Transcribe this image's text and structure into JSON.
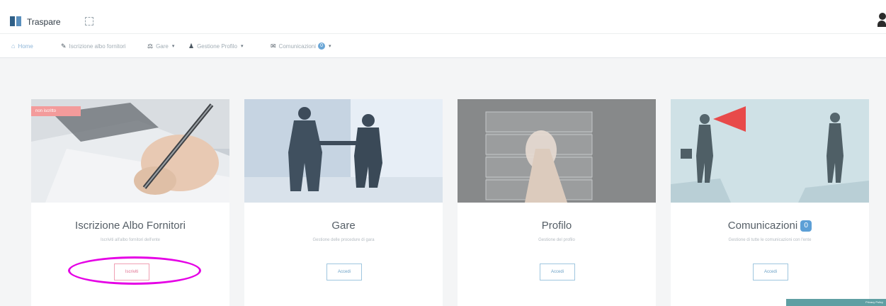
{
  "app": {
    "title": "Traspare"
  },
  "nav": {
    "items": [
      {
        "label": "Home",
        "icon": "home-icon",
        "active": true
      },
      {
        "label": "Iscrizione albo fornitori",
        "icon": "pencil-icon"
      },
      {
        "label": "Gare",
        "icon": "gavel-icon",
        "dropdown": true
      },
      {
        "label": "Gestione Profilo",
        "icon": "user-icon",
        "dropdown": true
      },
      {
        "label": "Comunicazioni",
        "icon": "comments-icon",
        "dropdown": true,
        "badge": "0"
      }
    ]
  },
  "cards": [
    {
      "title": "Iscrizione Albo Fornitori",
      "subtitle": "Iscriviti all'albo fornitori dell'ente",
      "button": "Iscriviti",
      "ribbon": "non iscritto"
    },
    {
      "title": "Gare",
      "subtitle": "Gestione delle procedure di gara",
      "button": "Accedi"
    },
    {
      "title": "Profilo",
      "subtitle": "Gestione del profilo",
      "button": "Accedi"
    },
    {
      "title": "Comunicazioni",
      "subtitle": "Gestione di tutte le comunicazioni con l'ente",
      "button": "Accedi",
      "badge": "0"
    }
  ],
  "footer": {
    "label": "Privacy Policy"
  },
  "colors": {
    "accent": "#5c9fd6",
    "highlight": "#e500e5",
    "ribbon": "#f39b9b"
  }
}
